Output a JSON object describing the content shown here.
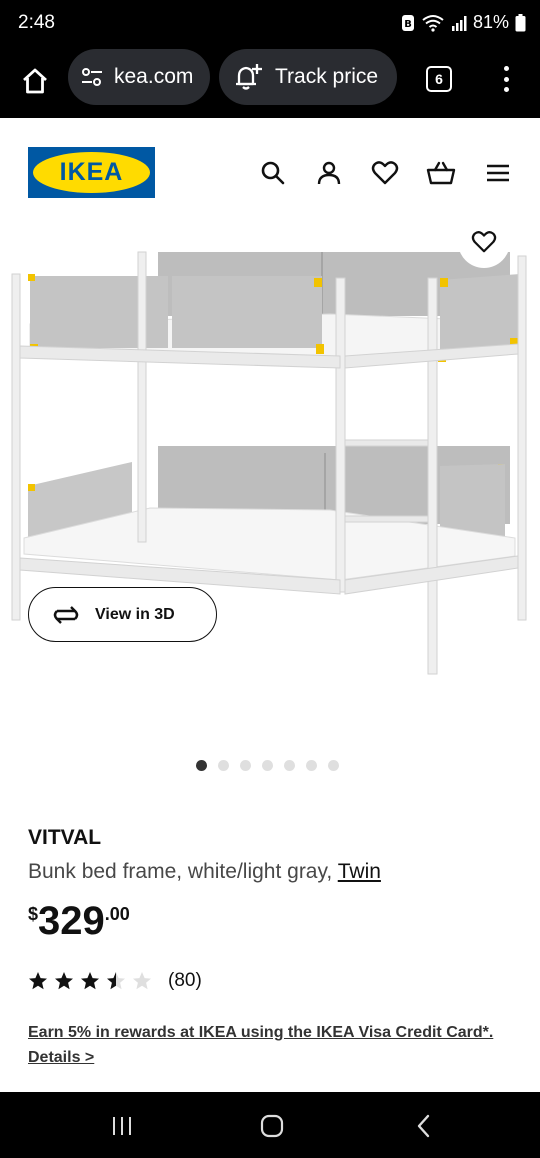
{
  "status": {
    "time": "2:48",
    "battery": "81%"
  },
  "browser": {
    "url": "kea.com",
    "track_label": "Track price",
    "tab_count": "6"
  },
  "site": {
    "logo_text": "IKEA",
    "brand_blue": "#0058a3",
    "brand_yellow": "#ffdb00"
  },
  "product": {
    "view3d_label": "View in 3D",
    "carousel": {
      "count": 7,
      "active": 1
    },
    "name": "VITVAL",
    "desc": "Bunk bed frame, white/light gray, ",
    "variant": "Twin",
    "price": {
      "currency": "$",
      "main": "329",
      "decimal": ".00"
    },
    "rating": {
      "stars": 3.5,
      "max": 5,
      "count": "(80)"
    },
    "promo": "Earn 5% in rewards at IKEA using the IKEA Visa Credit Card*. Details >"
  },
  "icons": {
    "home": "home-icon",
    "site_settings": "tune-icon",
    "track": "bell-plus-icon",
    "search": "search-icon",
    "account": "person-icon",
    "wishlist": "heart-icon",
    "cart": "basket-icon",
    "menu": "hamburger-icon",
    "view3d": "rotate-3d-icon"
  }
}
